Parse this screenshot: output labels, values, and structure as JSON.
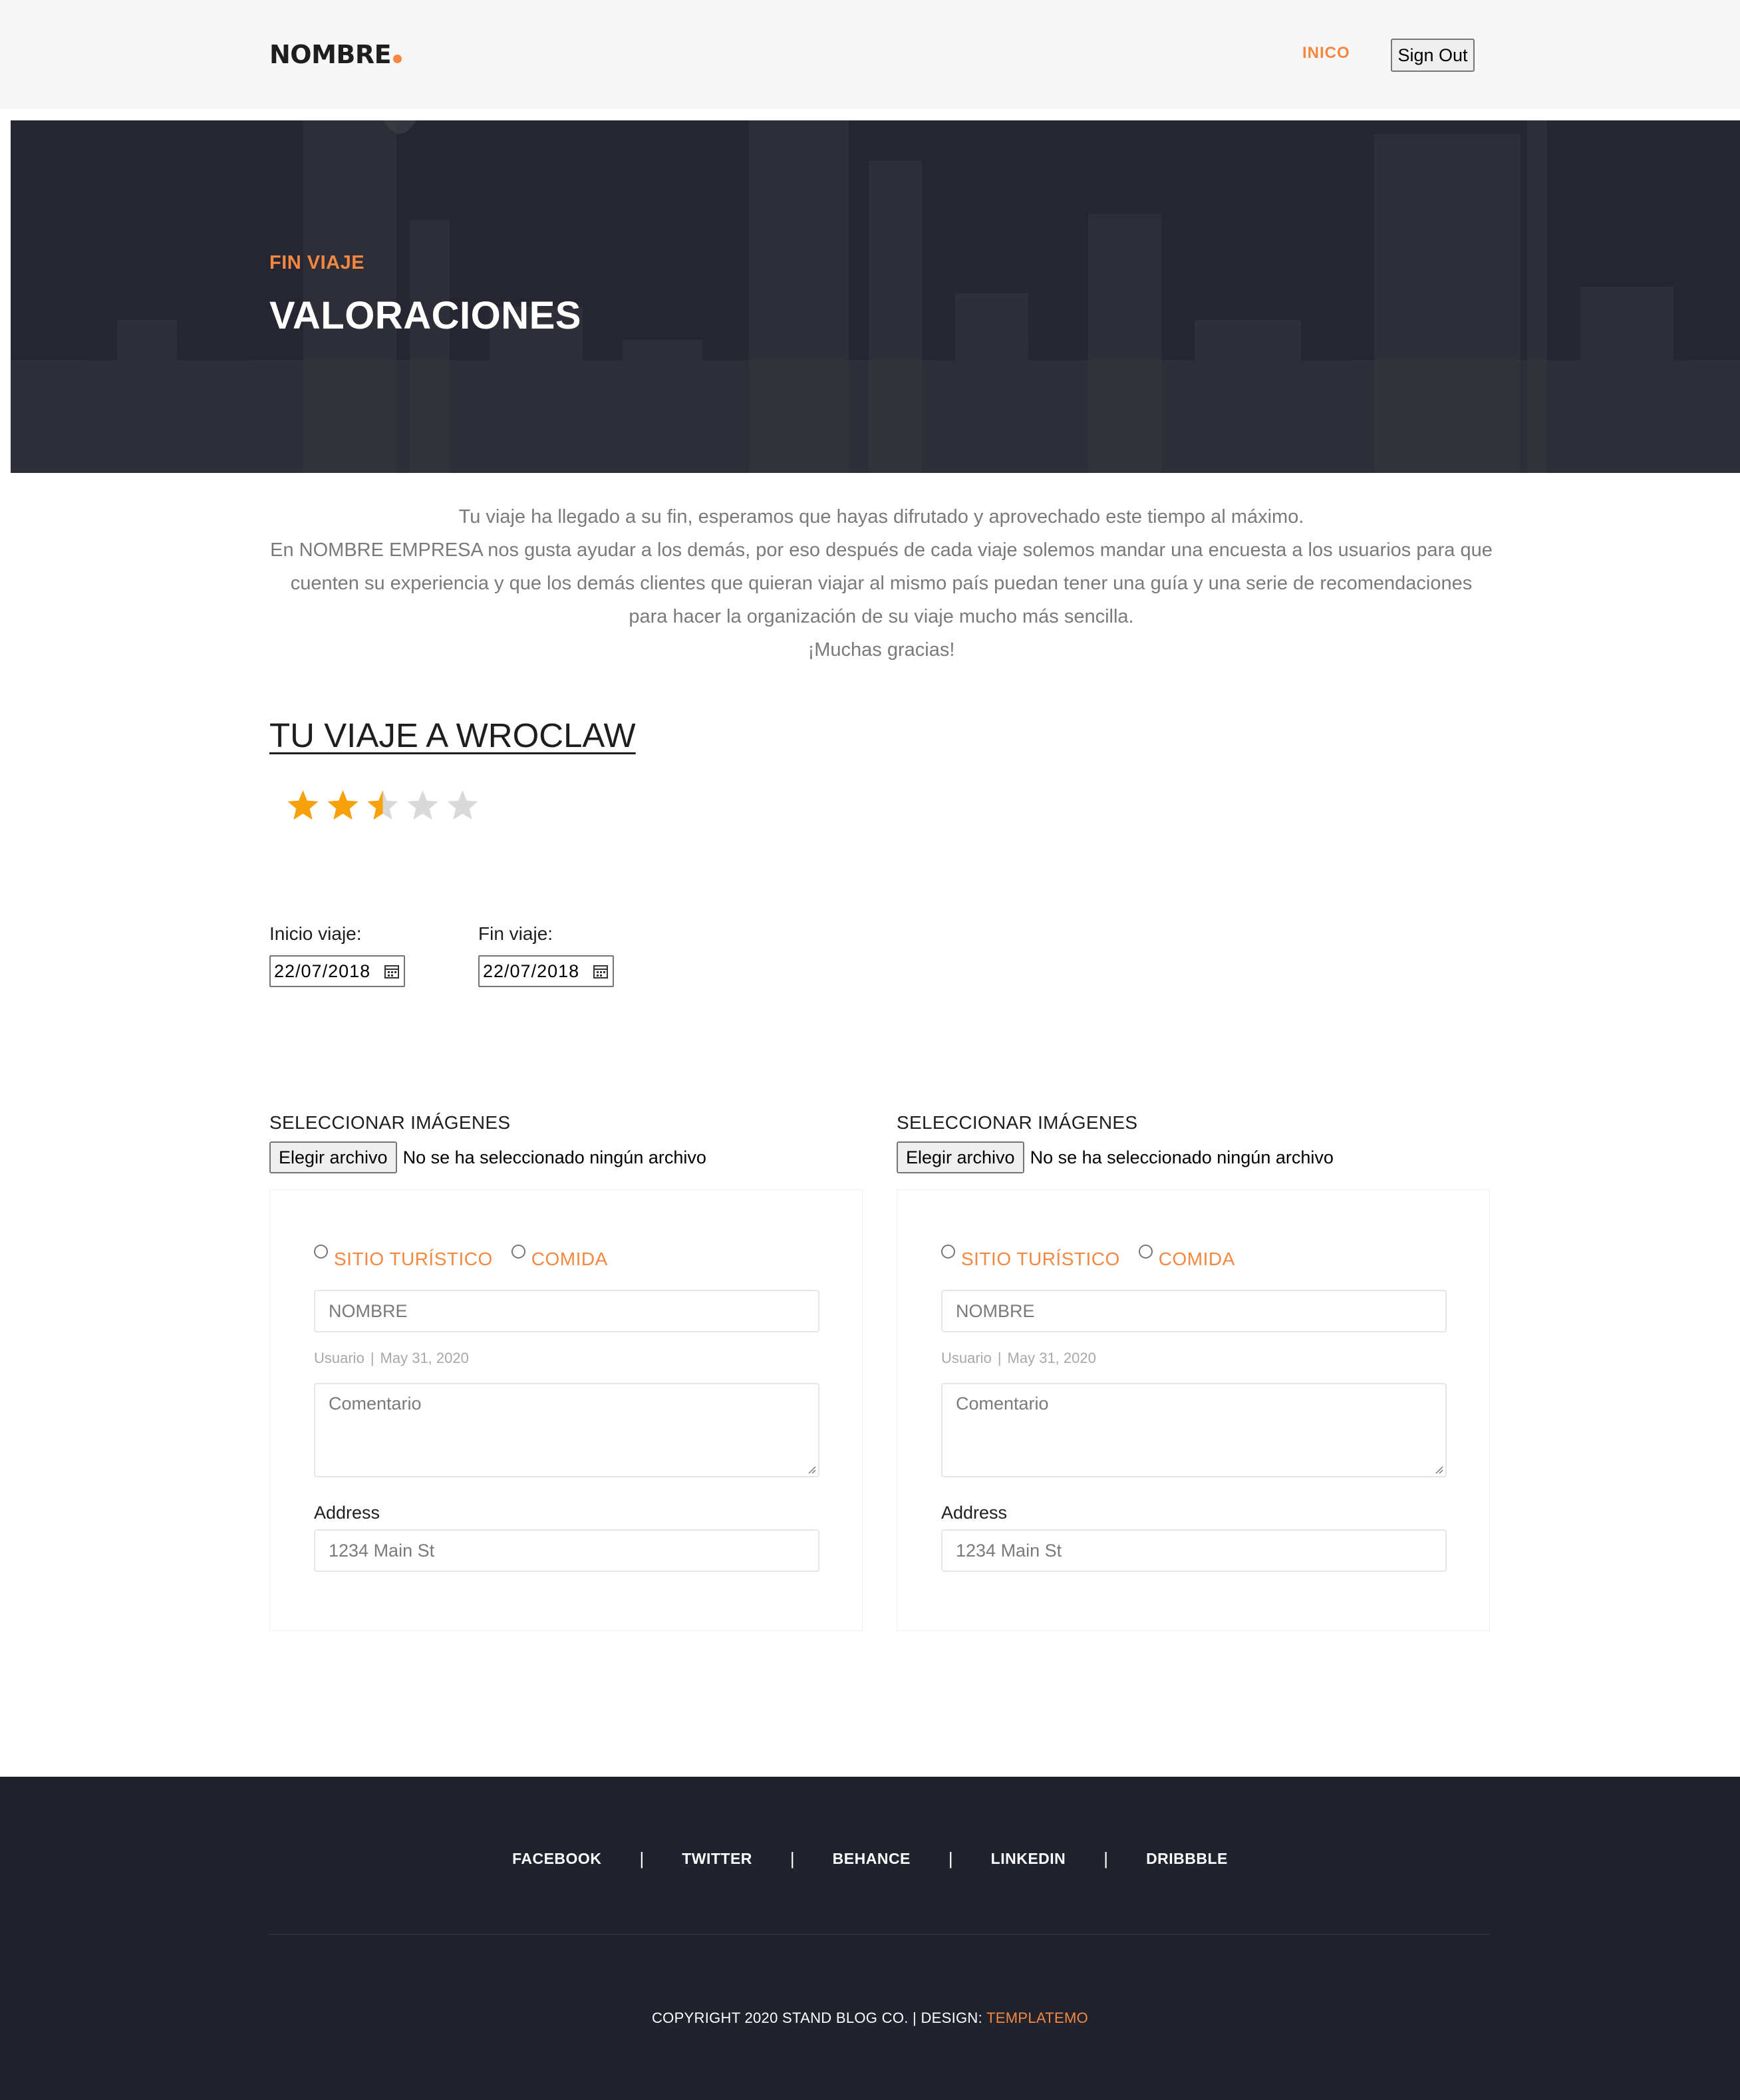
{
  "colors": {
    "accent": "#f48840",
    "star_filled": "#f7a10b",
    "star_empty": "#d9d9d9",
    "footer_bg": "#20232e"
  },
  "header": {
    "brand": "NOMBRE",
    "nav_home": "INICO",
    "sign_out": "Sign Out"
  },
  "hero": {
    "eyebrow": "FIN VIAJE",
    "title": "VALORACIONES"
  },
  "intro": {
    "lines": [
      "Tu viaje ha llegado a su fin, esperamos que hayas difrutado y aprovechado este tiempo al máximo.",
      "En NOMBRE EMPRESA nos gusta ayudar a los demás, por eso después de cada viaje solemos mandar una encuesta a los usuarios para que cuenten su experiencia y que los demás clientes que quieran viajar al mismo país puedan tener una guía y una serie de recomendaciones para hacer la organización de su viaje mucho más sencilla.",
      "¡Muchas gracias!"
    ]
  },
  "trip": {
    "title": "TU VIAJE A WROCLAW",
    "rating": 2.5,
    "rating_max": 5
  },
  "dates": {
    "start_label": "Inicio viaje:",
    "start_value": "22/07/2018",
    "end_label": "Fin viaje:",
    "end_value": "22/07/2018"
  },
  "cards": [
    {
      "file_title": "SELECCIONAR IMÁGENES",
      "file_button": "Elegir archivo",
      "file_status": "No se ha seleccionado ningún archivo",
      "radio_1": "SITIO TURÍSTICO",
      "radio_2": "COMIDA",
      "name_placeholder": "NOMBRE",
      "meta_user": "Usuario",
      "meta_date": "May 31, 2020",
      "comment_placeholder": "Comentario",
      "address_label": "Address",
      "address_placeholder": "1234 Main St"
    },
    {
      "file_title": "SELECCIONAR IMÁGENES",
      "file_button": "Elegir archivo",
      "file_status": "No se ha seleccionado ningún archivo",
      "radio_1": "SITIO TURÍSTICO",
      "radio_2": "COMIDA",
      "name_placeholder": "NOMBRE",
      "meta_user": "Usuario",
      "meta_date": "May 31, 2020",
      "comment_placeholder": "Comentario",
      "address_label": "Address",
      "address_placeholder": "1234 Main St"
    }
  ],
  "footer": {
    "social": [
      "FACEBOOK",
      "TWITTER",
      "BEHANCE",
      "LINKEDIN",
      "DRIBBBLE"
    ],
    "separator": "|",
    "copyright": "COPYRIGHT 2020 STAND BLOG CO. | DESIGN: ",
    "design_credit": "TEMPLATEMO"
  }
}
